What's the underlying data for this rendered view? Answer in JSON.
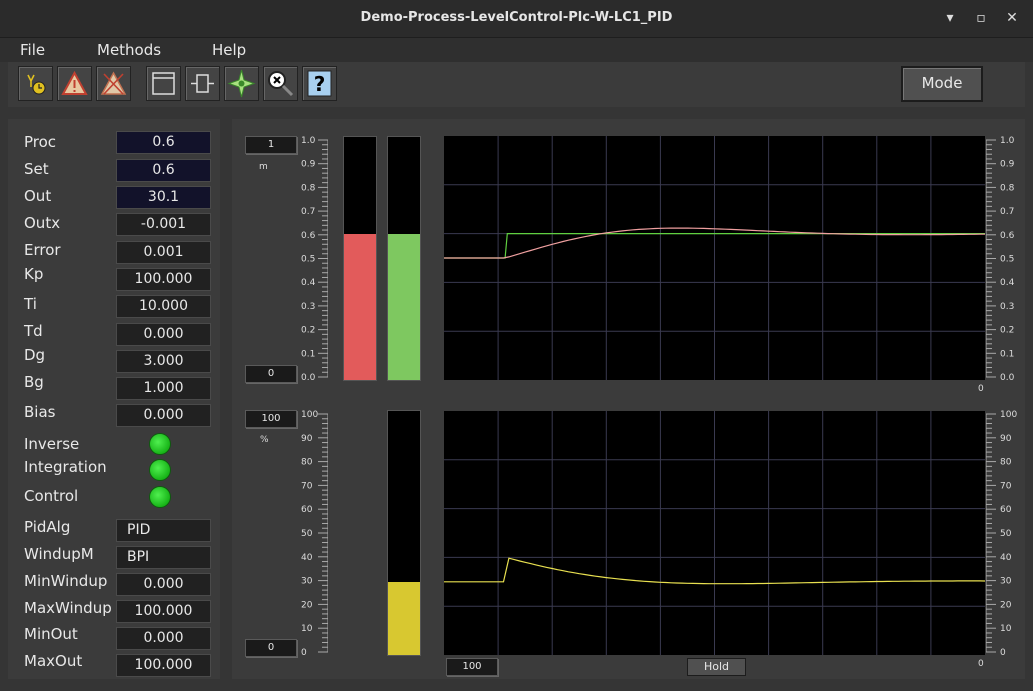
{
  "window": {
    "title": "Demo-Process-LevelControl-Plc-W-LC1_PID",
    "minimize_glyph": "▾",
    "maximize_glyph": "▫",
    "close_glyph": "✕"
  },
  "menu": {
    "file": "File",
    "methods": "Methods",
    "help": "Help"
  },
  "toolbar": {
    "buttons": [
      "graph-icon",
      "alarm-icon",
      "block-icon",
      "object-icon",
      "crossref-icon",
      "open-icon",
      "zoom-reset-icon",
      "help-icon"
    ],
    "help_glyph": "?",
    "mode_label": "Mode"
  },
  "params": {
    "proc": {
      "label": "Proc",
      "value": "0.6"
    },
    "set": {
      "label": "Set",
      "value": "0.6"
    },
    "out": {
      "label": "Out",
      "value": "30.1"
    },
    "outx": {
      "label": "Outx",
      "value": "-0.001"
    },
    "error": {
      "label": "Error",
      "value": "0.001"
    },
    "kp": {
      "label": "Kp",
      "value": "100.000"
    },
    "ti": {
      "label": "Ti",
      "value": "10.000"
    },
    "td": {
      "label": "Td",
      "value": "0.000"
    },
    "dg": {
      "label": "Dg",
      "value": "3.000"
    },
    "bg": {
      "label": "Bg",
      "value": "1.000"
    },
    "bias": {
      "label": "Bias",
      "value": "0.000"
    },
    "inverse": {
      "label": "Inverse",
      "on": true
    },
    "integration": {
      "label": "Integration",
      "on": true
    },
    "control": {
      "label": "Control",
      "on": true
    },
    "pidalg": {
      "label": "PidAlg",
      "value": "PID"
    },
    "windupm": {
      "label": "WindupM",
      "value": "BPI"
    },
    "minwindup": {
      "label": "MinWindup",
      "value": "0.000"
    },
    "maxwindup": {
      "label": "MaxWindup",
      "value": "100.000"
    },
    "minout": {
      "label": "MinOut",
      "value": "0.000"
    },
    "maxout": {
      "label": "MaxOut",
      "value": "100.000"
    }
  },
  "trend_top": {
    "range_max": "1",
    "range_min": "0",
    "unit": "m",
    "scale_labels": [
      "0.0",
      "0.1",
      "0.2",
      "0.3",
      "0.4",
      "0.5",
      "0.6",
      "0.7",
      "0.8",
      "0.9",
      "1.0"
    ],
    "bar_proc_value": 0.6,
    "bar_set_value": 0.6,
    "proc_color": "#e25b5b",
    "set_color": "#7ec860",
    "proc_curve_color": "#f0a0a0",
    "set_curve_color": "#60d040",
    "zero_label": "0"
  },
  "trend_bottom": {
    "range_max": "100",
    "range_min": "0",
    "unit": "%",
    "scale_labels": [
      "0",
      "10",
      "20",
      "30",
      "40",
      "50",
      "60",
      "70",
      "80",
      "90",
      "100"
    ],
    "bar_out_value": 30.1,
    "out_color": "#d8c830",
    "out_curve_color": "#e8e050",
    "zero_label": "0",
    "time_range": "100",
    "hold_label": "Hold"
  }
}
